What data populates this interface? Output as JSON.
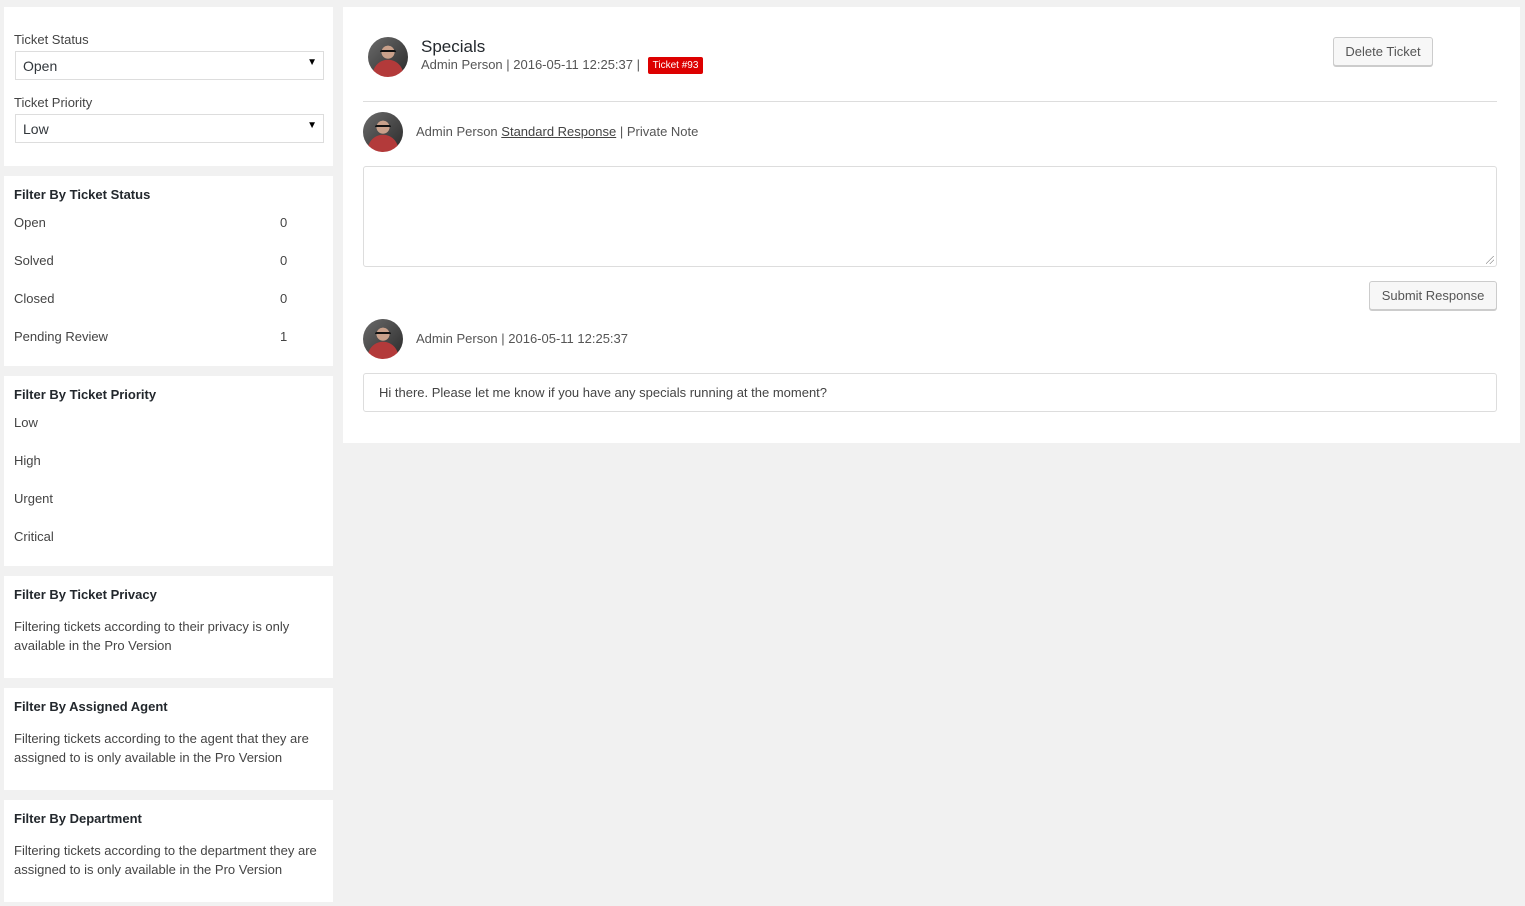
{
  "ticket_settings": {
    "status_label": "Ticket Status",
    "status_value": "Open",
    "priority_label": "Ticket Priority",
    "priority_value": "Low",
    "dropdown_icon": "triangle-down-icon"
  },
  "filter_status": {
    "title": "Filter By Ticket Status",
    "items": [
      {
        "label": "Open",
        "count": "0"
      },
      {
        "label": "Solved",
        "count": "0"
      },
      {
        "label": "Closed",
        "count": "0"
      },
      {
        "label": "Pending Review",
        "count": "1"
      }
    ]
  },
  "filter_priority": {
    "title": "Filter By Ticket Priority",
    "items": [
      "Low",
      "High",
      "Urgent",
      "Critical"
    ]
  },
  "filter_privacy": {
    "title": "Filter By Ticket Privacy",
    "note": "Filtering tickets according to their privacy is only available in the Pro Version"
  },
  "filter_agent": {
    "title": "Filter By Assigned Agent",
    "note": "Filtering tickets according to the agent that they are assigned to is only available in the Pro Version"
  },
  "filter_department": {
    "title": "Filter By Department",
    "note": "Filtering tickets according to the department they are assigned to is only available in the Pro Version"
  },
  "ticket": {
    "title": "Specials",
    "meta": "Admin Person | 2016-05-11 12:25:37 |",
    "badge": "Ticket #93",
    "badge_color": "#dd0000",
    "delete_label": "Delete Ticket"
  },
  "response": {
    "author": "Admin Person",
    "standard_response": "Standard Response",
    "separator": "|",
    "private_note": "Private Note",
    "submit_label": "Submit Response"
  },
  "message": {
    "meta": "Admin Person | 2016-05-11 12:25:37",
    "body": "Hi there. Please let me know if you have any specials running at the moment?"
  }
}
